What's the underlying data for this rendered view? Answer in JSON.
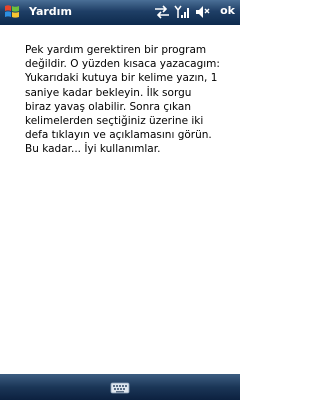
{
  "window": {
    "title": "Yardım",
    "ok_label": "ok"
  },
  "status_icons": [
    "start-icon",
    "connectivity-icon",
    "signal-icon",
    "volume-icon"
  ],
  "help": {
    "text": "Pek yardım gerektiren bir program\ndeğildir. O yüzden kısaca yazacagım:\nYukarıdaki kutuya bir kelime yazın, 1\nsaniye kadar bekleyin. İlk sorgu\nbiraz yavaş olabilir. Sonra çıkan\nkelimelerden seçtiğiniz üzerine iki\ndefa tıklayın ve açıklamasını görün.\nBu kadar... İyi kullanımlar."
  },
  "bottom": {
    "icon": "keyboard-icon"
  },
  "colors": {
    "titlebar": "#1f3f66",
    "bottombar": "#1b3657",
    "text": "#000000",
    "background": "#ffffff"
  }
}
